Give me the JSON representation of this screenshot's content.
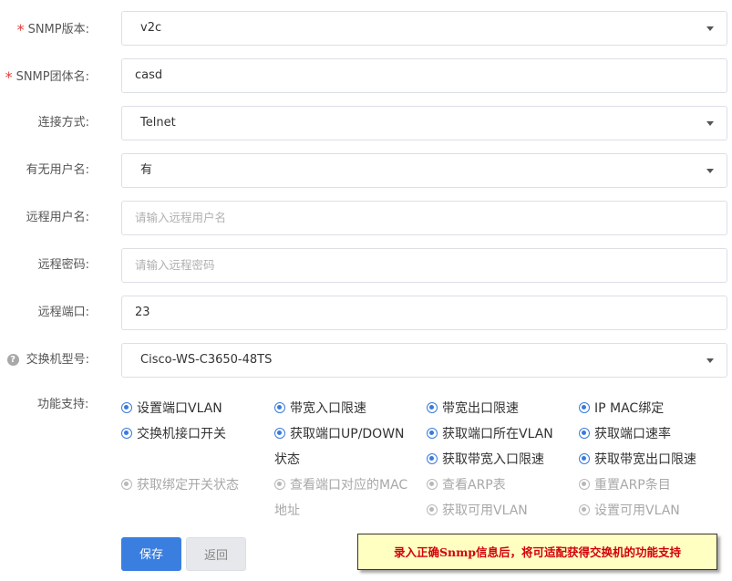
{
  "form": {
    "snmp_version": {
      "required": "*",
      "label": "SNMP版本:",
      "value": "v2c"
    },
    "snmp_community": {
      "required": "*",
      "label": "SNMP团体名:",
      "value": "casd"
    },
    "connect_method": {
      "label": "连接方式:",
      "value": "Telnet"
    },
    "has_username": {
      "label": "有无用户名:",
      "value": "有"
    },
    "remote_username": {
      "label": "远程用户名:",
      "placeholder": "请输入远程用户名"
    },
    "remote_password": {
      "label": "远程密码:",
      "placeholder": "请输入远程密码"
    },
    "remote_port": {
      "label": "远程端口:",
      "value": "23"
    },
    "switch_model": {
      "help_icon": "question-icon",
      "help_glyph": "?",
      "label": "交换机型号:",
      "value": "Cisco-WS-C3650-48TS"
    }
  },
  "functions": {
    "label": "功能支持:",
    "options": [
      {
        "label": "设置端口VLAN",
        "enabled": true
      },
      {
        "label": "带宽入口限速",
        "enabled": true
      },
      {
        "label": "带宽出口限速",
        "enabled": true
      },
      {
        "label": "IP MAC绑定",
        "enabled": true
      },
      {
        "label": "交换机接口开关",
        "enabled": true
      },
      {
        "label": "获取端口UP/DOWN",
        "continuation": "状态",
        "enabled": true
      },
      {
        "label": "获取端口所在VLAN",
        "enabled": true
      },
      {
        "label": "获取端口速率",
        "enabled": true
      },
      {
        "label": "获取带宽入口限速",
        "enabled": true
      },
      {
        "label": "获取带宽出口限速",
        "enabled": true
      },
      {
        "label": "获取绑定开关状态",
        "enabled": false
      },
      {
        "label": "查看端口对应的MAC",
        "continuation": "地址",
        "enabled": false
      },
      {
        "label": "查看ARP表",
        "enabled": false
      },
      {
        "label": "重置ARP条目",
        "enabled": false
      },
      {
        "label": "获取可用VLAN",
        "enabled": false
      },
      {
        "label": "设置可用VLAN",
        "enabled": false
      }
    ]
  },
  "buttons": {
    "save": "保存",
    "back": "返回"
  },
  "tooltip": {
    "text": "录入正确Snmp信息后，将可适配获得交换机的功能支持"
  },
  "colors": {
    "accent": "#3a7fe0",
    "required": "#e23c39",
    "tooltip_bg": "#ffffc2",
    "tooltip_text": "#d4000a"
  }
}
